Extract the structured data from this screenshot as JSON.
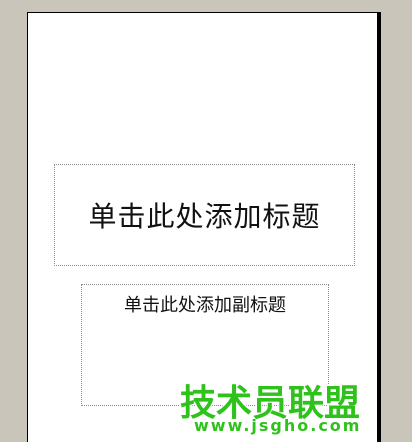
{
  "slide": {
    "title_placeholder": "单击此处添加标题",
    "subtitle_placeholder": "单击此处添加副标题"
  },
  "watermark": {
    "brand": "技术员联盟",
    "url": "www.jsgho.com"
  },
  "colors": {
    "canvas_background": "#c9c5bb",
    "slide_background": "#ffffff",
    "placeholder_border": "#8a8a8a",
    "watermark_green": "#2fc21c"
  }
}
